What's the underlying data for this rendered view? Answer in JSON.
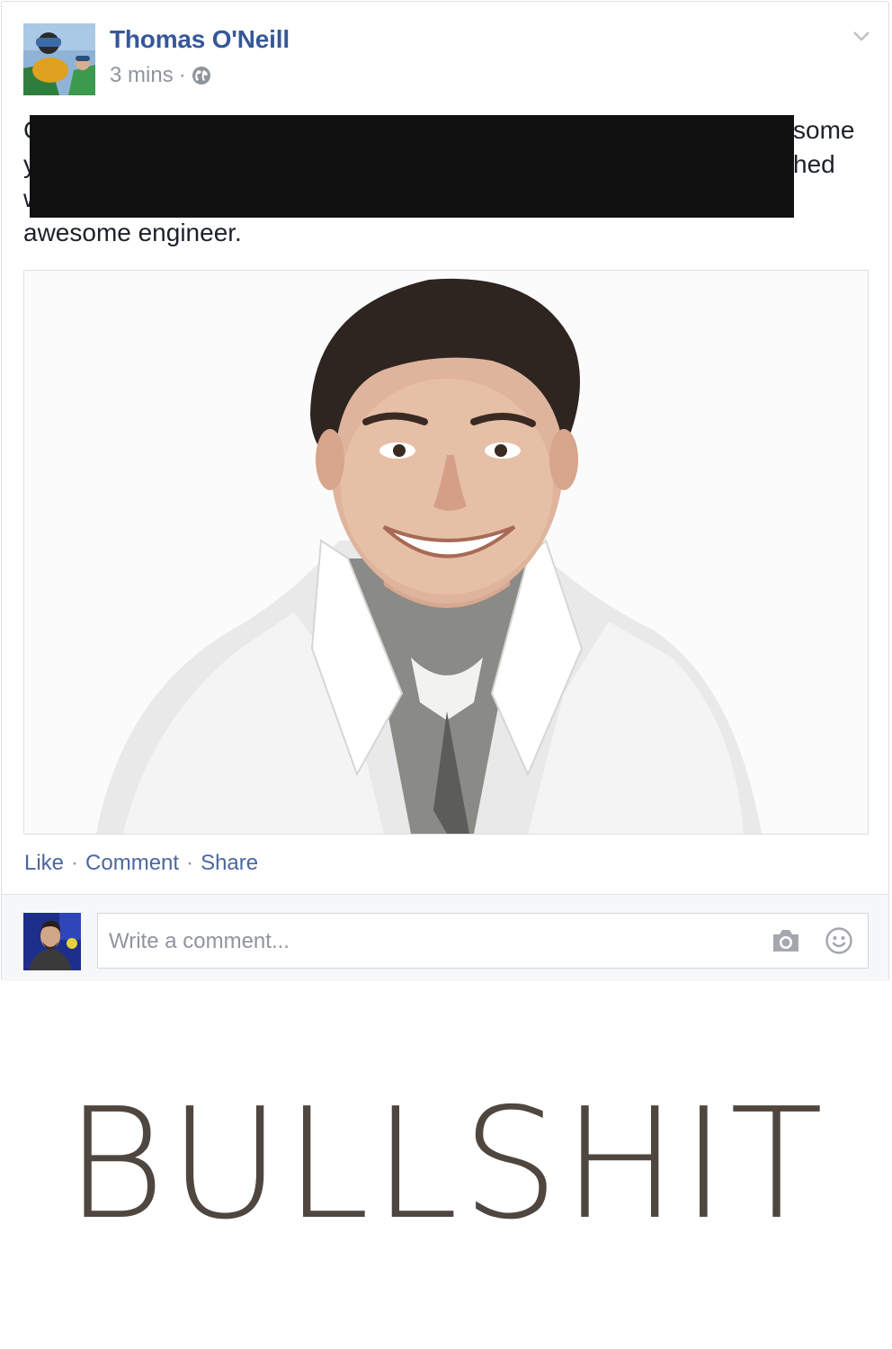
{
  "post": {
    "author_name": "Thomas O'Neill",
    "timestamp": "3 mins",
    "meta_separator": "·",
    "privacy_icon": "globe-icon",
    "menu_icon": "chevron-down-icon",
    "text_lines": [
      "C",
      "y",
      "w",
      "awesome engineer."
    ],
    "text_line_ends": [
      "some",
      "hed",
      ""
    ],
    "redacted": true,
    "photo_icon": "person-in-lab-coat-photo"
  },
  "actions": {
    "like": "Like",
    "comment": "Comment",
    "share": "Share",
    "separator": "·"
  },
  "comment_box": {
    "placeholder": "Write a comment...",
    "camera_icon": "camera-icon",
    "emoji_icon": "emoji-icon"
  },
  "caption": "BULLSHIT",
  "colors": {
    "author_link": "#365899",
    "action_link": "#4b67a1",
    "meta_gray": "#90949c",
    "caption": "#4f4640",
    "redaction": "#111010"
  }
}
